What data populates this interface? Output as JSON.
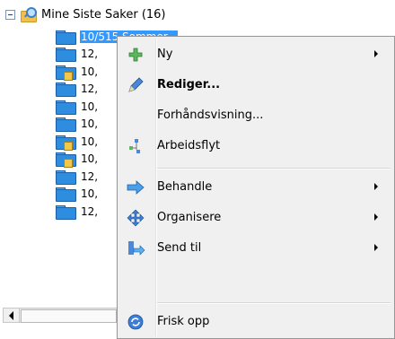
{
  "tree": {
    "header": "Mine Siste Saker (16)",
    "items": [
      {
        "label": "10/515 Sommer...",
        "locked": false,
        "selected": true
      },
      {
        "label": "12,",
        "locked": false
      },
      {
        "label": "10,",
        "locked": true
      },
      {
        "label": "12,",
        "locked": false
      },
      {
        "label": "10,",
        "locked": false
      },
      {
        "label": "10,",
        "locked": false
      },
      {
        "label": "10,",
        "locked": true
      },
      {
        "label": "10,",
        "locked": true
      },
      {
        "label": "12,",
        "locked": false
      },
      {
        "label": "10,",
        "locked": false
      },
      {
        "label": "12,",
        "locked": false
      }
    ]
  },
  "context_menu": {
    "items": [
      {
        "label": "Ny",
        "icon": "new-plus-icon",
        "submenu": true,
        "bold": false
      },
      {
        "label": "Rediger...",
        "icon": "pencil-icon",
        "submenu": false,
        "bold": true
      },
      {
        "label": "Forhåndsvisning...",
        "icon": "",
        "submenu": false,
        "bold": false
      },
      {
        "label": "Arbeidsflyt",
        "icon": "workflow-icon",
        "submenu": false,
        "bold": false
      },
      {
        "label": "Behandle",
        "icon": "process-arrow-icon",
        "submenu": true,
        "bold": false
      },
      {
        "label": "Organisere",
        "icon": "organize-icon",
        "submenu": true,
        "bold": false
      },
      {
        "label": "Send til",
        "icon": "send-to-icon",
        "submenu": true,
        "bold": false
      },
      {
        "label": "Frisk opp",
        "icon": "refresh-icon",
        "submenu": false,
        "bold": false
      }
    ]
  },
  "colors": {
    "selection": "#3399ff",
    "menu_bg": "#f0f0f0",
    "folder_blue": "#2f8de0"
  }
}
